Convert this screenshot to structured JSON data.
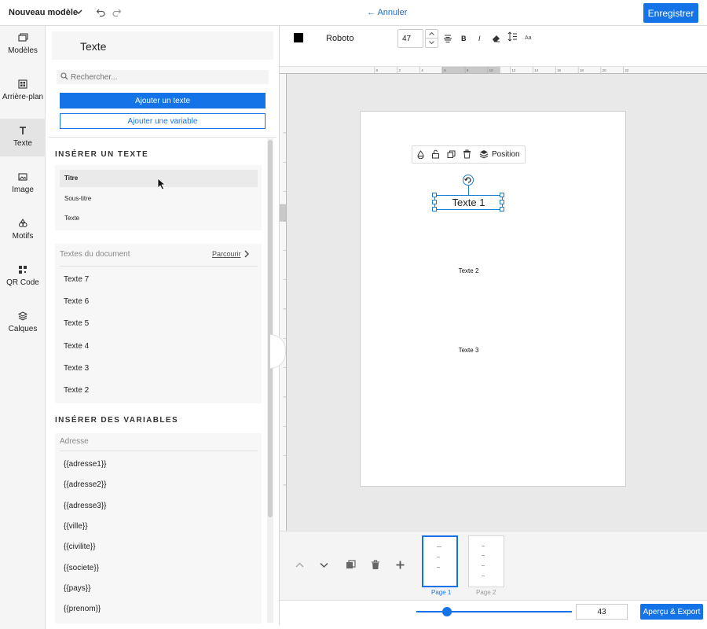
{
  "topbar": {
    "model_name": "Nouveau modèle",
    "cancel_label": "Annuler",
    "save_label": "Enregistrer"
  },
  "nav": {
    "items": [
      {
        "label": "Modèles",
        "icon": "templates-icon"
      },
      {
        "label": "Arrière-plan",
        "icon": "background-icon"
      },
      {
        "label": "Texte",
        "icon": "text-icon",
        "active": true
      },
      {
        "label": "Image",
        "icon": "image-icon"
      },
      {
        "label": "Motifs",
        "icon": "shapes-icon"
      },
      {
        "label": "QR Code",
        "icon": "qrcode-icon"
      },
      {
        "label": "Calques",
        "icon": "layers-icon"
      }
    ]
  },
  "panel": {
    "title": "Texte",
    "search_placeholder": "Rechercher...",
    "add_text_label": "Ajouter un texte",
    "add_variable_label": "Ajouter une variable",
    "insert_text_title": "INSÉRER UN TEXTE",
    "insert_items": [
      "Titre",
      "Sous-titre",
      "Texte"
    ],
    "doc_texts_title": "Textes du document",
    "browse_label": "Parcourir",
    "doc_texts": [
      "Texte 7",
      "Texte 6",
      "Texte 5",
      "Texte 4",
      "Texte 3",
      "Texte 2"
    ],
    "insert_vars_title": "INSÉRER DES VARIABLES",
    "address_title": "Adresse",
    "variables": [
      "{{adresse1}}",
      "{{adresse2}}",
      "{{adresse3}}",
      "{{ville}}",
      "{{civilite}}",
      "{{societe}}",
      "{{pays}}",
      "{{prenom}}"
    ]
  },
  "toolbar": {
    "color": "#000000",
    "font": "Roboto",
    "size": "47"
  },
  "ruler": {
    "ticks": [
      "0",
      "2",
      "4",
      "6",
      "8",
      "10",
      "12",
      "14",
      "16",
      "18",
      "20",
      "22"
    ]
  },
  "canvas": {
    "position_label": "Position",
    "text1": "Texte 1",
    "text2": "Texte 2",
    "text3": "Texte 3"
  },
  "pages": {
    "page1": "Page 1",
    "page2": "Page 2"
  },
  "footer": {
    "zoom": "43",
    "export_label": "Aperçu & Export"
  },
  "colors": {
    "accent": "#1473e6"
  }
}
